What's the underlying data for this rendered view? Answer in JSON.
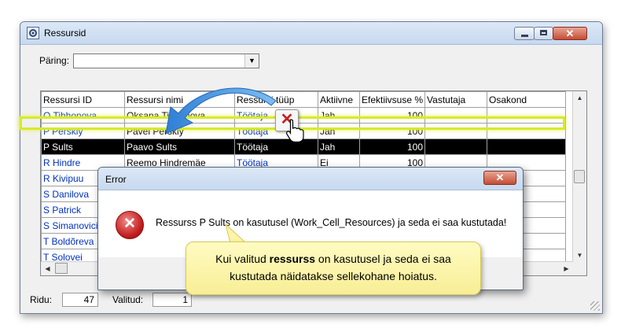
{
  "window": {
    "title": "Ressursid"
  },
  "query": {
    "label": "Päring:",
    "value": ""
  },
  "grid": {
    "columns": [
      "Ressursi ID",
      "Ressursi nimi",
      "Ressursi tüüp",
      "Aktiivne",
      "Efektiivsuse %",
      "Vastutaja",
      "Osakond"
    ],
    "rows": [
      {
        "id": "O Tihhonova",
        "name": "Oksana Tihhonova",
        "type": "Töötaja",
        "active": "Jah",
        "eff": "100",
        "resp": "",
        "dept": ""
      },
      {
        "id": "P Perskiy",
        "name": "Pavel Perskiy",
        "type": "Töötaja",
        "active": "Jah",
        "eff": "100",
        "resp": "",
        "dept": ""
      },
      {
        "id": "P Sults",
        "name": "Paavo Sults",
        "type": "Töötaja",
        "active": "Jah",
        "eff": "100",
        "resp": "",
        "dept": ""
      },
      {
        "id": "R Hindre",
        "name": "Reemo Hindremäe",
        "type": "Töötaja",
        "active": "Ei",
        "eff": "100",
        "resp": "",
        "dept": ""
      },
      {
        "id": "R Kivipuu",
        "name": "",
        "type": "",
        "active": "",
        "eff": "",
        "resp": "",
        "dept": ""
      },
      {
        "id": "S Danilova",
        "name": "",
        "type": "",
        "active": "",
        "eff": "",
        "resp": "",
        "dept": ""
      },
      {
        "id": "S Patrick",
        "name": "",
        "type": "",
        "active": "",
        "eff": "",
        "resp": "",
        "dept": ""
      },
      {
        "id": "S Simanovici",
        "name": "",
        "type": "",
        "active": "",
        "eff": "",
        "resp": "",
        "dept": ""
      },
      {
        "id": "T Boldõreva",
        "name": "",
        "type": "",
        "active": "",
        "eff": "",
        "resp": "",
        "dept": ""
      },
      {
        "id": "T Solovei",
        "name": "",
        "type": "",
        "active": "",
        "eff": "",
        "resp": "",
        "dept": ""
      }
    ]
  },
  "status": {
    "rows_label": "Ridu:",
    "rows_value": "47",
    "selected_label": "Valitud:",
    "selected_value": "1"
  },
  "dialog": {
    "title": "Error",
    "close_glyph": "✕",
    "message": "Ressurss P Sults on kasutusel (Work_Cell_Resources) ja seda ei saa kustutada!"
  },
  "callout": {
    "line1_pre": "Kui valitud ",
    "line1_bold": "ressurss",
    "line1_post": " on kasutusel ja seda ei saa",
    "line2": "kustutada näidatakse sellekohane hoiatus."
  },
  "icons": {
    "delete": "delete-x-icon",
    "error": "error-icon",
    "cursor": "hand-cursor-icon"
  },
  "colors": {
    "link": "#0030c0",
    "selection_outline": "#d7ea2a",
    "callout_bg": "#fff8b0",
    "arrow": "#3d8ee0"
  }
}
